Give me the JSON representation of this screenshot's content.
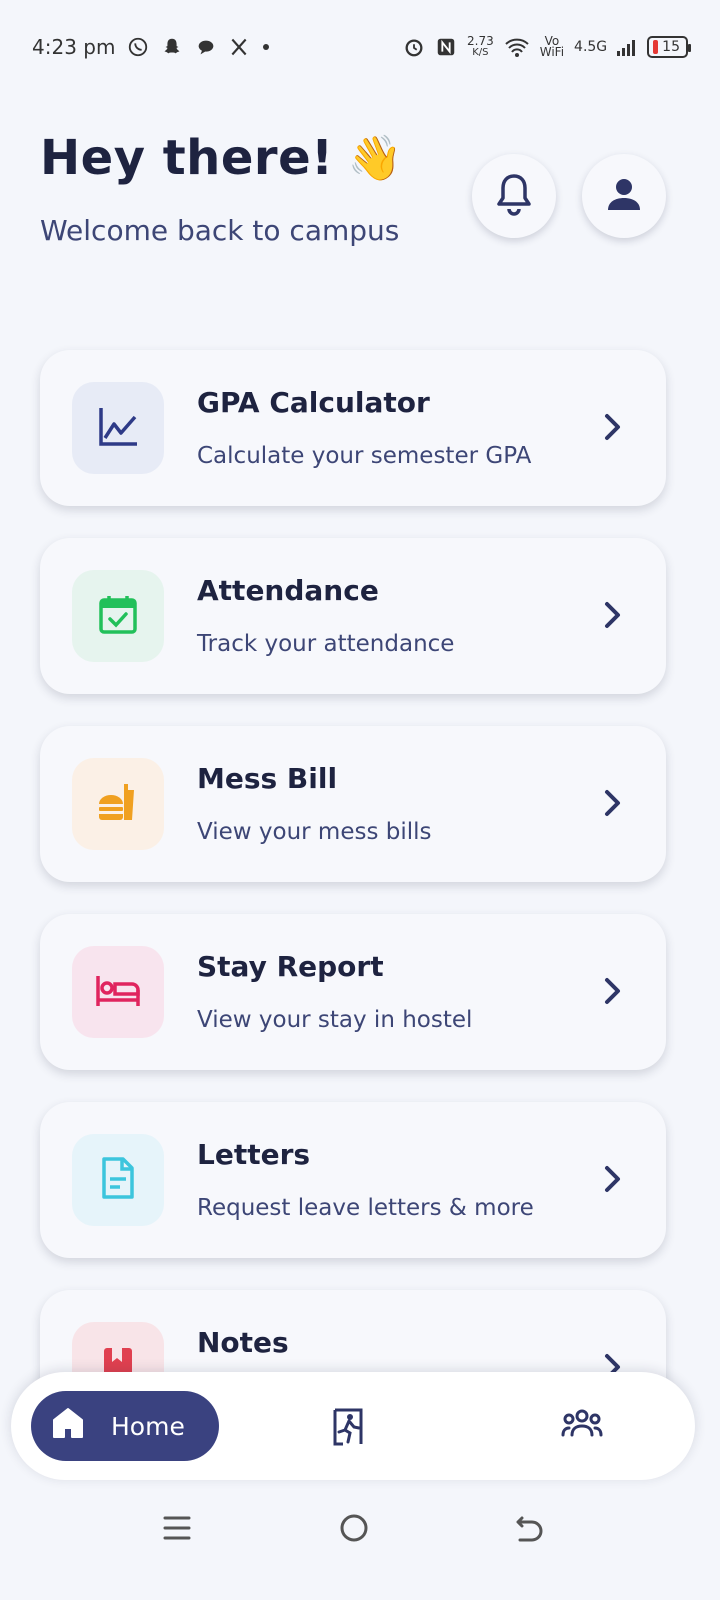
{
  "status_bar": {
    "time": "4:23 pm",
    "net_speed_value": "2.73",
    "net_speed_unit": "K/S",
    "volte_top": "Vo",
    "volte_bottom": "WiFi",
    "network_type": "4.5G",
    "battery": "15"
  },
  "header": {
    "title": "Hey there!",
    "wave": "👋",
    "subtitle": "Welcome back to campus"
  },
  "cards": [
    {
      "title": "GPA Calculator",
      "subtitle": "Calculate your semester GPA",
      "icon": "chart-line-icon",
      "icon_color": "#2e3a87",
      "bg": "#e7ebf6"
    },
    {
      "title": "Attendance",
      "subtitle": "Track your attendance",
      "icon": "calendar-check-icon",
      "icon_color": "#22c05a",
      "bg": "#e6f4ee"
    },
    {
      "title": "Mess Bill",
      "subtitle": "View your mess bills",
      "icon": "fastfood-icon",
      "icon_color": "#f0a020",
      "bg": "#fbf0e6"
    },
    {
      "title": "Stay Report",
      "subtitle": "View your stay in hostel",
      "icon": "bed-icon",
      "icon_color": "#e0245e",
      "bg": "#f8e4ee"
    },
    {
      "title": "Letters",
      "subtitle": "Request leave letters & more",
      "icon": "document-icon",
      "icon_color": "#3cc5dd",
      "bg": "#e6f4fa"
    },
    {
      "title": "Notes",
      "subtitle": "",
      "icon": "book-icon",
      "icon_color": "#e04050",
      "bg": "#f8e4e8"
    }
  ],
  "bottom_nav": {
    "home_label": "Home"
  },
  "colors": {
    "primary": "#3a4280",
    "text_dark": "#1e2340",
    "text_muted": "#3d4676",
    "background": "#f4f6fb"
  }
}
